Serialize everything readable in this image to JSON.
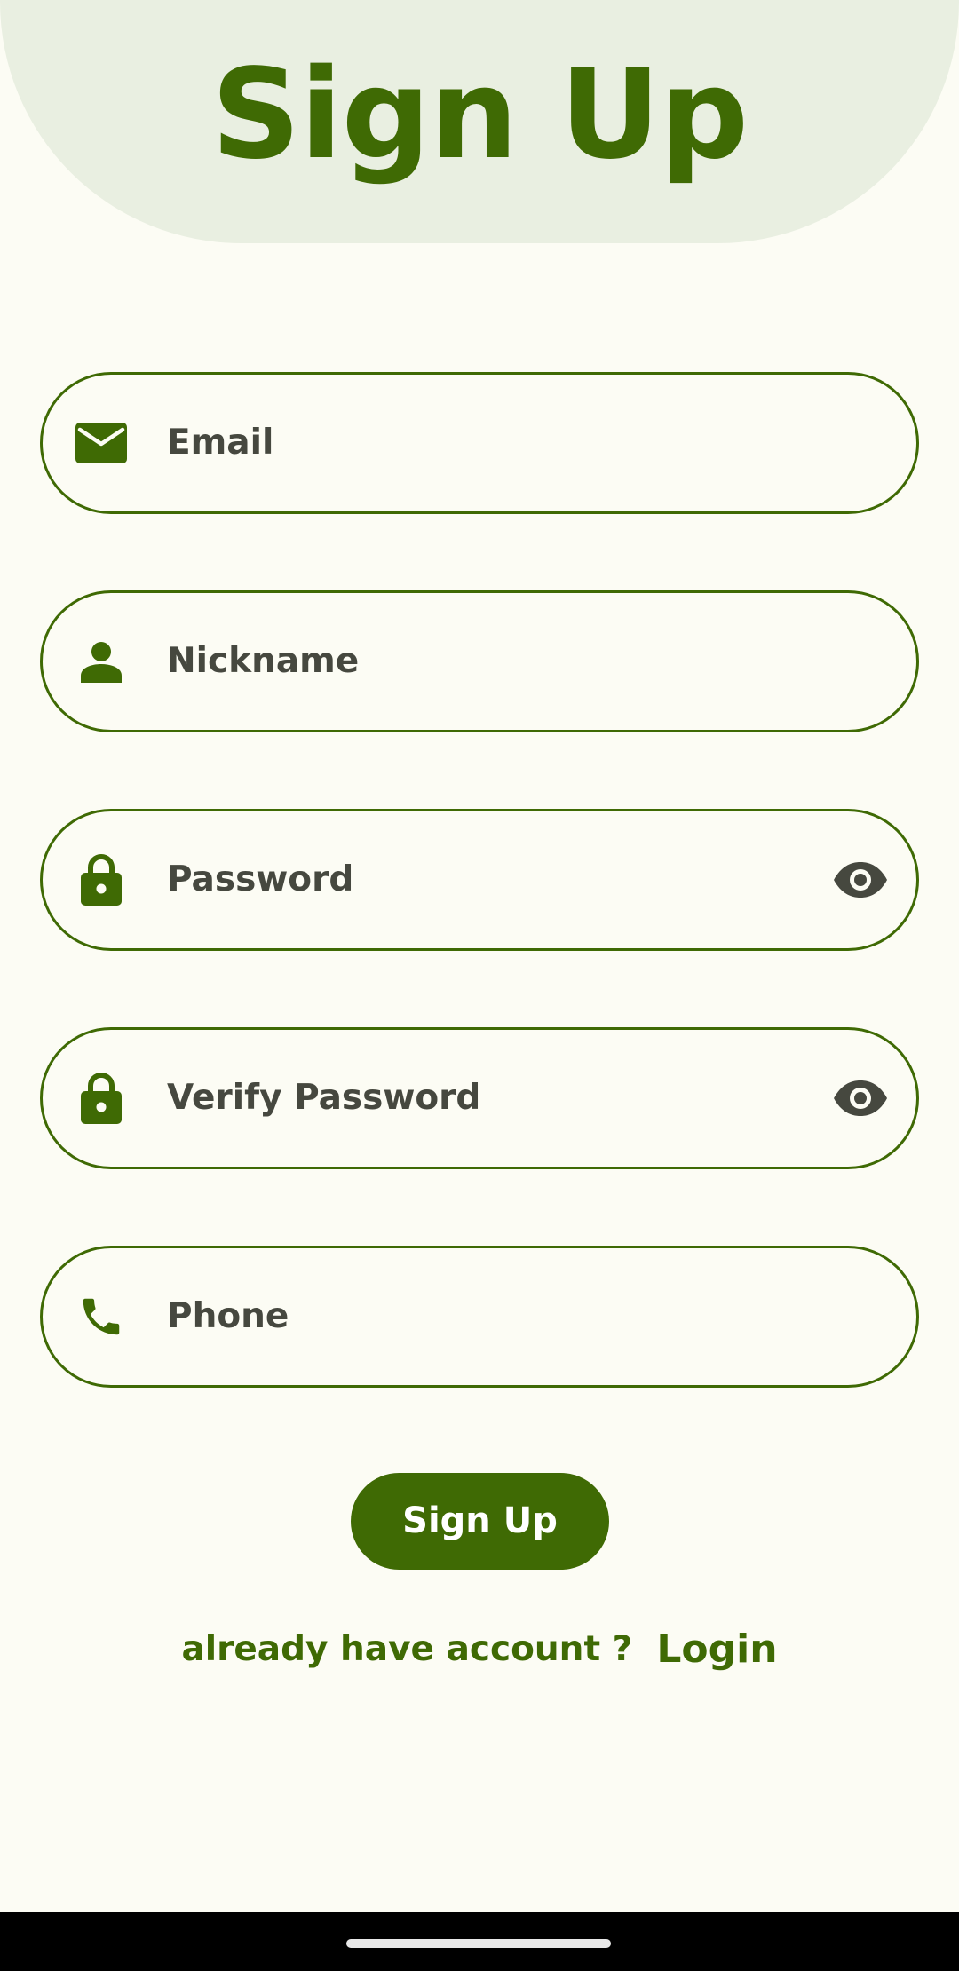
{
  "header": {
    "title": "Sign Up"
  },
  "form": {
    "fields": [
      {
        "label": "Email",
        "icon": "mail-icon"
      },
      {
        "label": "Nickname",
        "icon": "person-icon"
      },
      {
        "label": "Password",
        "icon": "lock-icon",
        "trailing_icon": "eye-icon"
      },
      {
        "label": "Verify Password",
        "icon": "lock-icon",
        "trailing_icon": "eye-icon"
      },
      {
        "label": "Phone",
        "icon": "phone-icon"
      }
    ],
    "submit_label": "Sign Up"
  },
  "footer": {
    "prompt": "already have account ?",
    "login_label": "Login"
  },
  "colors": {
    "brand": "#3f6a04",
    "background": "#fcfcf4",
    "header_background": "#e9efe1",
    "label_text": "#46483f"
  }
}
